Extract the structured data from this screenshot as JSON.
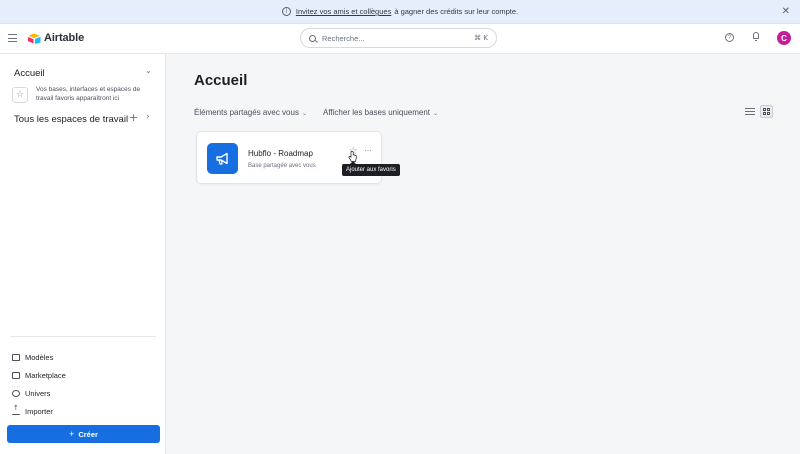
{
  "banner": {
    "link_text": "Invitez vos amis et collègues",
    "text": "à gagner des crédits sur leur compte.",
    "info_icon": "info-icon",
    "close_icon": "close-icon"
  },
  "header": {
    "logo_text": "Airtable",
    "search_placeholder": "Recherche...",
    "search_shortcut": "⌘ K",
    "avatar_initial": "C",
    "avatar_color": "#c21f9b"
  },
  "sidebar": {
    "home_label": "Accueil",
    "favorites_hint": "Vos bases, interfaces et espaces de travail favoris apparaîtront ici",
    "workspaces_label": "Tous les espaces de travail",
    "bottom_items": [
      {
        "label": "Modèles",
        "icon": "book-icon"
      },
      {
        "label": "Marketplace",
        "icon": "marketplace-icon"
      },
      {
        "label": "Univers",
        "icon": "globe-icon"
      },
      {
        "label": "Importer",
        "icon": "upload-icon"
      }
    ],
    "create_label": "Créer"
  },
  "main": {
    "title": "Accueil",
    "filter_shared": "Éléments partagés avec vous",
    "filter_bases": "Afficher les bases uniquement",
    "card": {
      "name": "Hubflo - Roadmap",
      "subtitle": "Base partagée avec vous",
      "tile_color": "#166ee1",
      "icon": "megaphone-icon"
    },
    "tooltip": "Ajouter aux favoris"
  },
  "colors": {
    "accent": "#166ee1",
    "banner_bg": "#e6eefc",
    "main_bg": "#f5f6f8"
  }
}
